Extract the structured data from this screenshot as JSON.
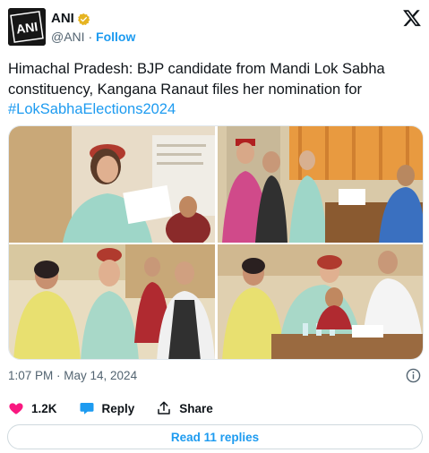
{
  "author": {
    "display_name": "ANI",
    "handle": "@ANI",
    "separator": "·",
    "follow_label": "Follow",
    "avatar_icon": "ani-logo",
    "verified_icon": "gold-verified-badge-icon"
  },
  "platform_icon": "x-logo-icon",
  "tweet": {
    "text": "Himachal Pradesh: BJP candidate from Mandi Lok Sabha constituency, Kangana Ranaut files her nomination for ",
    "hashtag": "#LokSabhaElections2024"
  },
  "media": {
    "photos": [
      {
        "name": "photo-woman-reading-document"
      },
      {
        "name": "photo-officials-handing-papers"
      },
      {
        "name": "photo-seated-group"
      },
      {
        "name": "photo-signing-nomination"
      }
    ]
  },
  "meta": {
    "timestamp": "1:07 PM · May 14, 2024"
  },
  "actions": {
    "like_count": "1.2K",
    "reply_label": "Reply",
    "share_label": "Share"
  },
  "read_replies_label": "Read 11 replies",
  "colors": {
    "accent": "#1d9bf0",
    "like": "#f91880",
    "text": "#0f1419",
    "secondary": "#536471",
    "border": "#cfd9de"
  }
}
